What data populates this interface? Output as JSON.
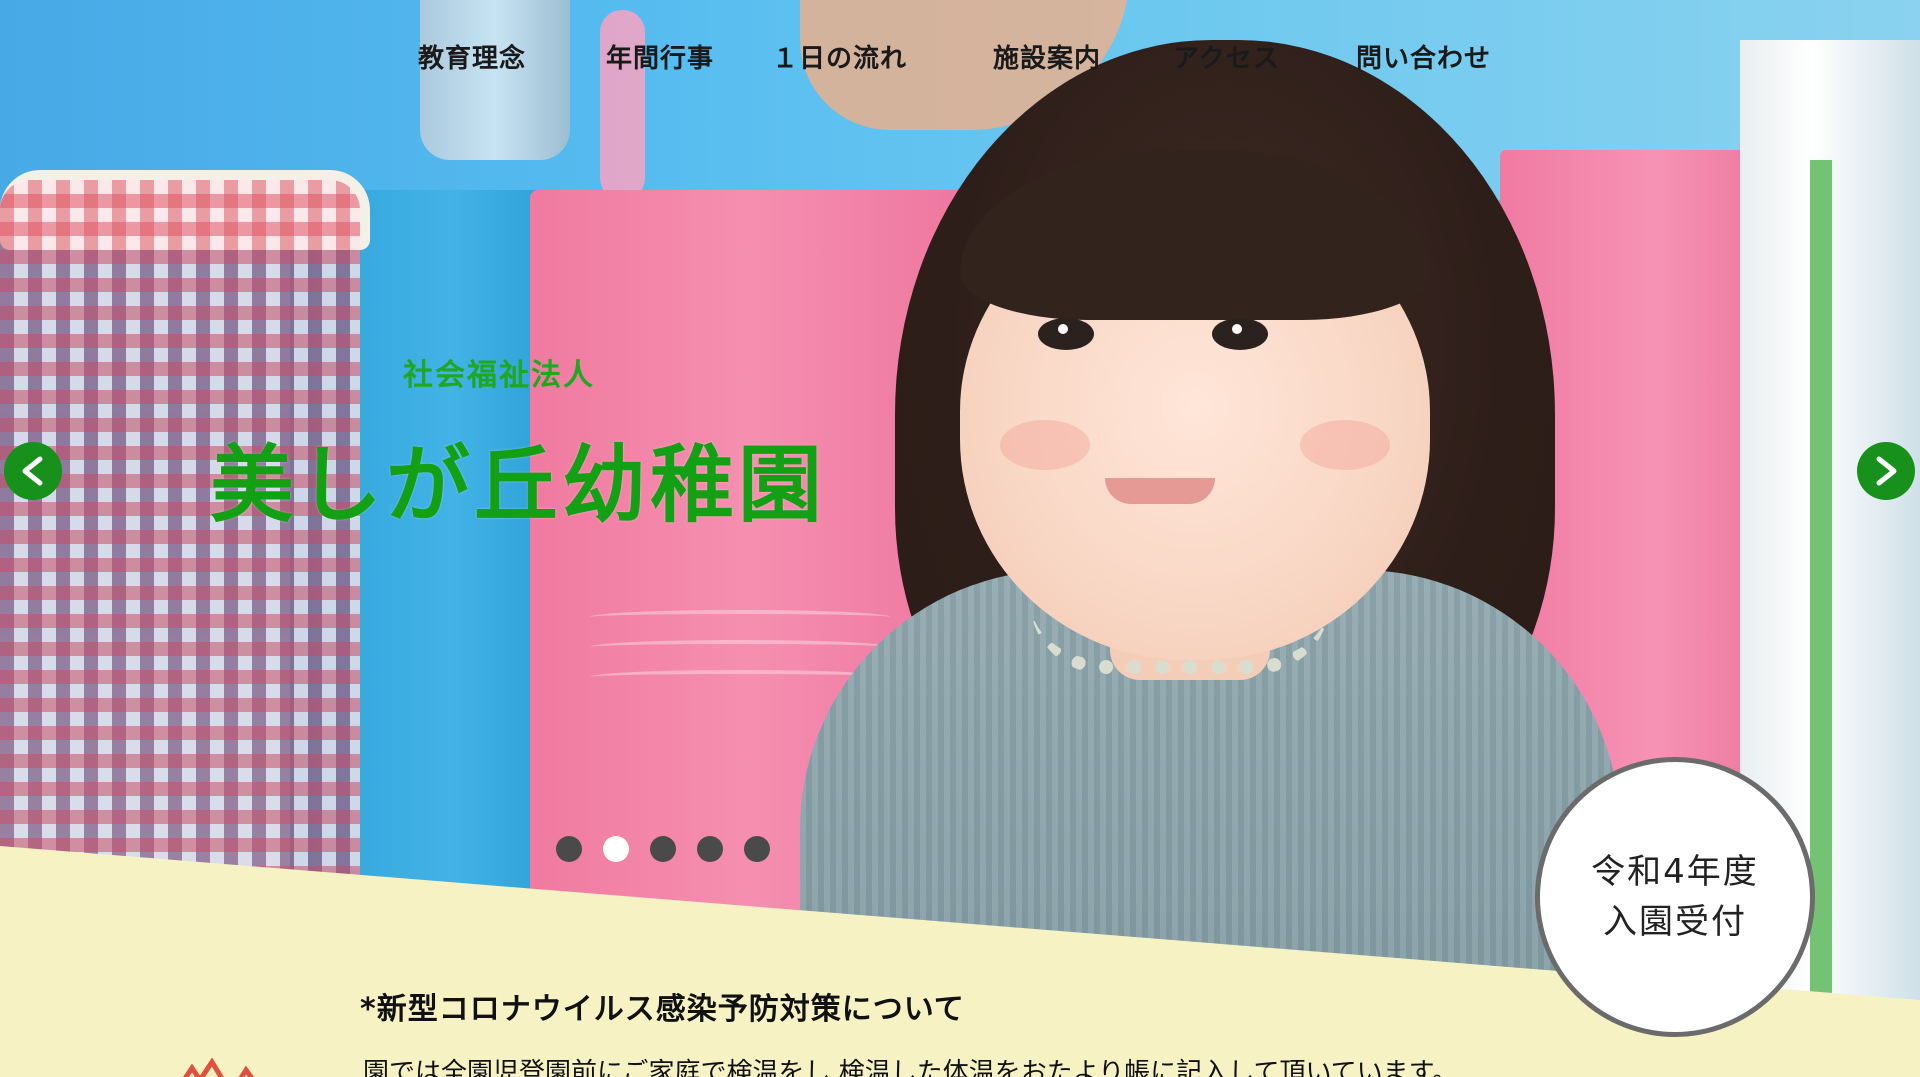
{
  "nav": {
    "items": [
      {
        "label": "教育理念"
      },
      {
        "label": "年間行事"
      },
      {
        "label": "１日の流れ"
      },
      {
        "label": "施設案内"
      },
      {
        "label": "アクセス"
      },
      {
        "label": "問い合わせ"
      }
    ]
  },
  "hero": {
    "org_label": "社会福祉法人",
    "title": "美しが丘幼稚園",
    "arrows": {
      "prev_icon": "chevron-left-icon",
      "next_icon": "chevron-right-icon"
    },
    "slider": {
      "slide_count": 5,
      "active_index": 1
    }
  },
  "badge": {
    "line1": "令和4年度",
    "line2": "入園受付"
  },
  "notice": {
    "title": "*新型コロナウイルス感染予防対策について",
    "body": "園では全園児登園前にご家庭で検温をし,検温した体温をおたより帳に記入して頂いています。"
  },
  "colors": {
    "title_green": "#14a014",
    "arrow_green": "#17911b",
    "panel_yellow": "#f7f2c4",
    "dot_inactive": "#4a4a4a",
    "dot_active": "#ffffff"
  }
}
